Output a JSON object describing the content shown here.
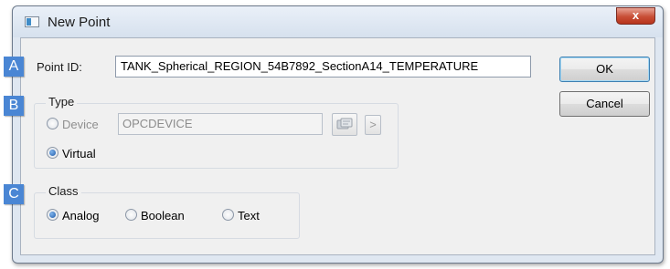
{
  "window": {
    "title": "New Point",
    "close_glyph": "x"
  },
  "callouts": {
    "a": "A",
    "b": "B",
    "c": "C"
  },
  "point_id": {
    "label": "Point ID:",
    "value": "TANK_Spherical_REGION_54B7892_SectionA14_TEMPERATURE"
  },
  "type_group": {
    "title": "Type",
    "device_label": "Device",
    "device_value": "OPCDEVICE",
    "virtual_label": "Virtual",
    "selected": "Virtual",
    "browse_icon": "device-browse-icon",
    "expand_glyph": ">"
  },
  "class_group": {
    "title": "Class",
    "options": [
      "Analog",
      "Boolean",
      "Text"
    ],
    "selected": "Analog"
  },
  "buttons": {
    "ok": "OK",
    "cancel": "Cancel"
  },
  "colors": {
    "callout_badge": "#4a86d4",
    "close_button": "#c84e36",
    "radio_selected": "#1f5aa8"
  }
}
